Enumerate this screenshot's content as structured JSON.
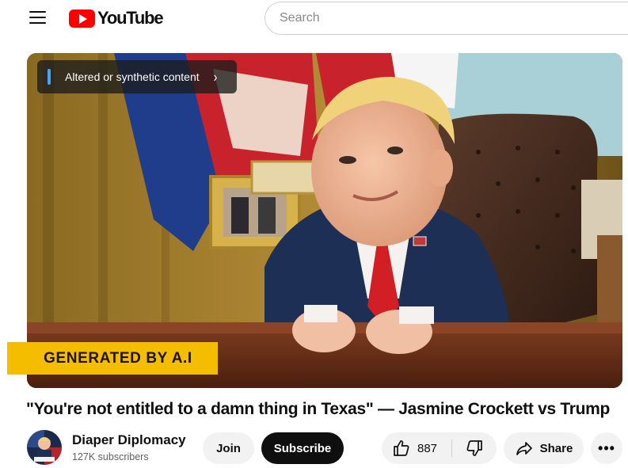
{
  "header": {
    "logo_text": "YouTube",
    "search_placeholder": "Search"
  },
  "player": {
    "notice": "Altered or synthetic content",
    "badge": "GENERATED BY A.I"
  },
  "video": {
    "title": "\"You're not entitled to a damn thing in Texas\" — Jasmine Crockett vs Trump"
  },
  "channel": {
    "name": "Diaper Diplomacy",
    "subscribers": "127K subscribers"
  },
  "actions": {
    "join": "Join",
    "subscribe": "Subscribe",
    "like_count": "887",
    "share": "Share",
    "more": "•••"
  },
  "colors": {
    "brand_red": "#ff0000",
    "badge_yellow": "#f5bd00",
    "notice_accent": "#3ea6ff"
  }
}
